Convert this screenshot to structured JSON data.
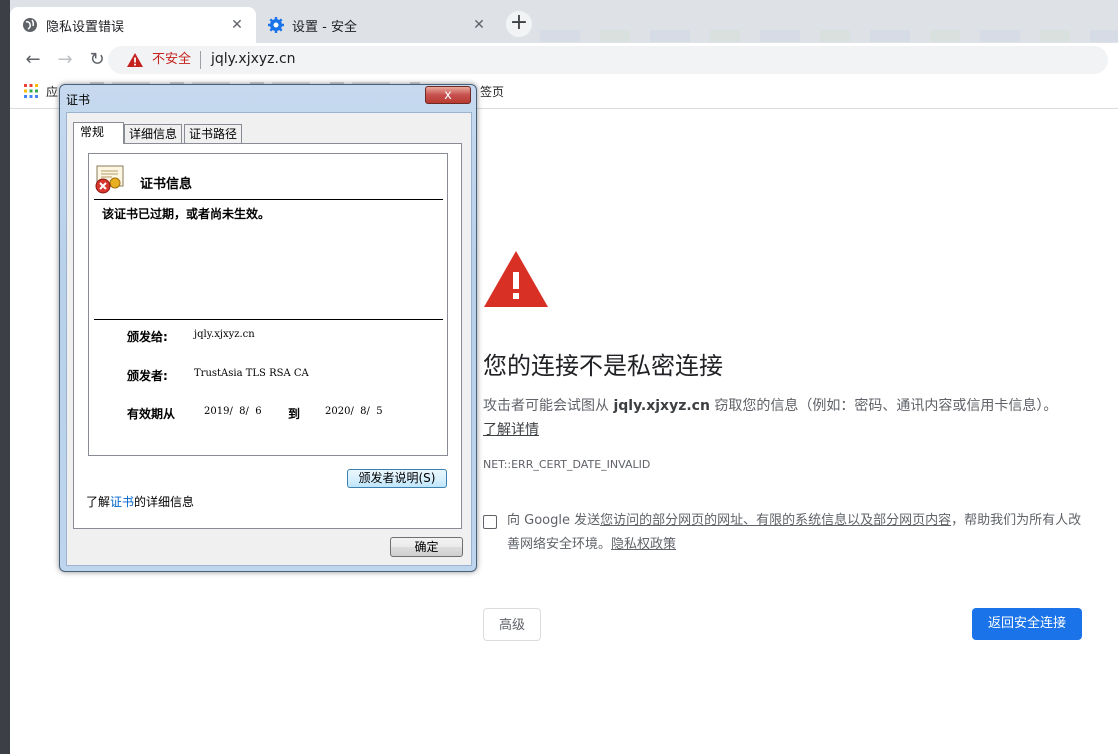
{
  "browser": {
    "tabs": [
      {
        "title": "隐私设置错误",
        "icon": "globe-icon"
      },
      {
        "title": "设置 - 安全",
        "icon": "gear-icon"
      }
    ],
    "new_tab": "+",
    "omnibox": {
      "security_label": "不安全",
      "url": "jqly.xjxyz.cn"
    },
    "bookmarks": {
      "apps_label": "应",
      "other_label": "签页"
    }
  },
  "error_page": {
    "heading": "您的连接不是私密连接",
    "desc_before": "攻击者可能会试图从 ",
    "desc_host": "jqly.xjxyz.cn",
    "desc_after": " 窃取您的信息（例如：密码、通讯内容或信用卡信息）。",
    "learn_more": "了解详情",
    "error_code": "NET::ERR_CERT_DATE_INVALID",
    "safebrowsing_before": "向 Google 发送",
    "safebrowsing_link": "您访问的部分网页的网址、有限的系统信息以及部分网页内容",
    "safebrowsing_after": "，帮助我们为所有人改善网络安全环境。",
    "privacy_link": "隐私权政策",
    "advanced_button": "高级",
    "back_button": "返回安全连接",
    "colors": {
      "accent": "#1a73e8",
      "warning": "#d93025"
    }
  },
  "cert_dialog": {
    "title": "证书",
    "close": "x",
    "tabs": [
      "常规",
      "详细信息",
      "证书路径"
    ],
    "info_title": "证书信息",
    "message": "该证书已过期，或者尚未生效。",
    "issued_to_label": "颁发给:",
    "issued_to": "jqly.xjxyz.cn",
    "issued_by_label": "颁发者:",
    "issued_by": "TrustAsia TLS RSA CA",
    "valid_from_label": "有效期从",
    "valid_from": "2019/  8/  6",
    "to_label": "到",
    "valid_to": "2020/  8/  5",
    "issuer_statement": "颁发者说明(S)",
    "learn_prefix": "了解",
    "learn_link": "证书",
    "learn_suffix": "的详细信息",
    "ok": "确定"
  }
}
